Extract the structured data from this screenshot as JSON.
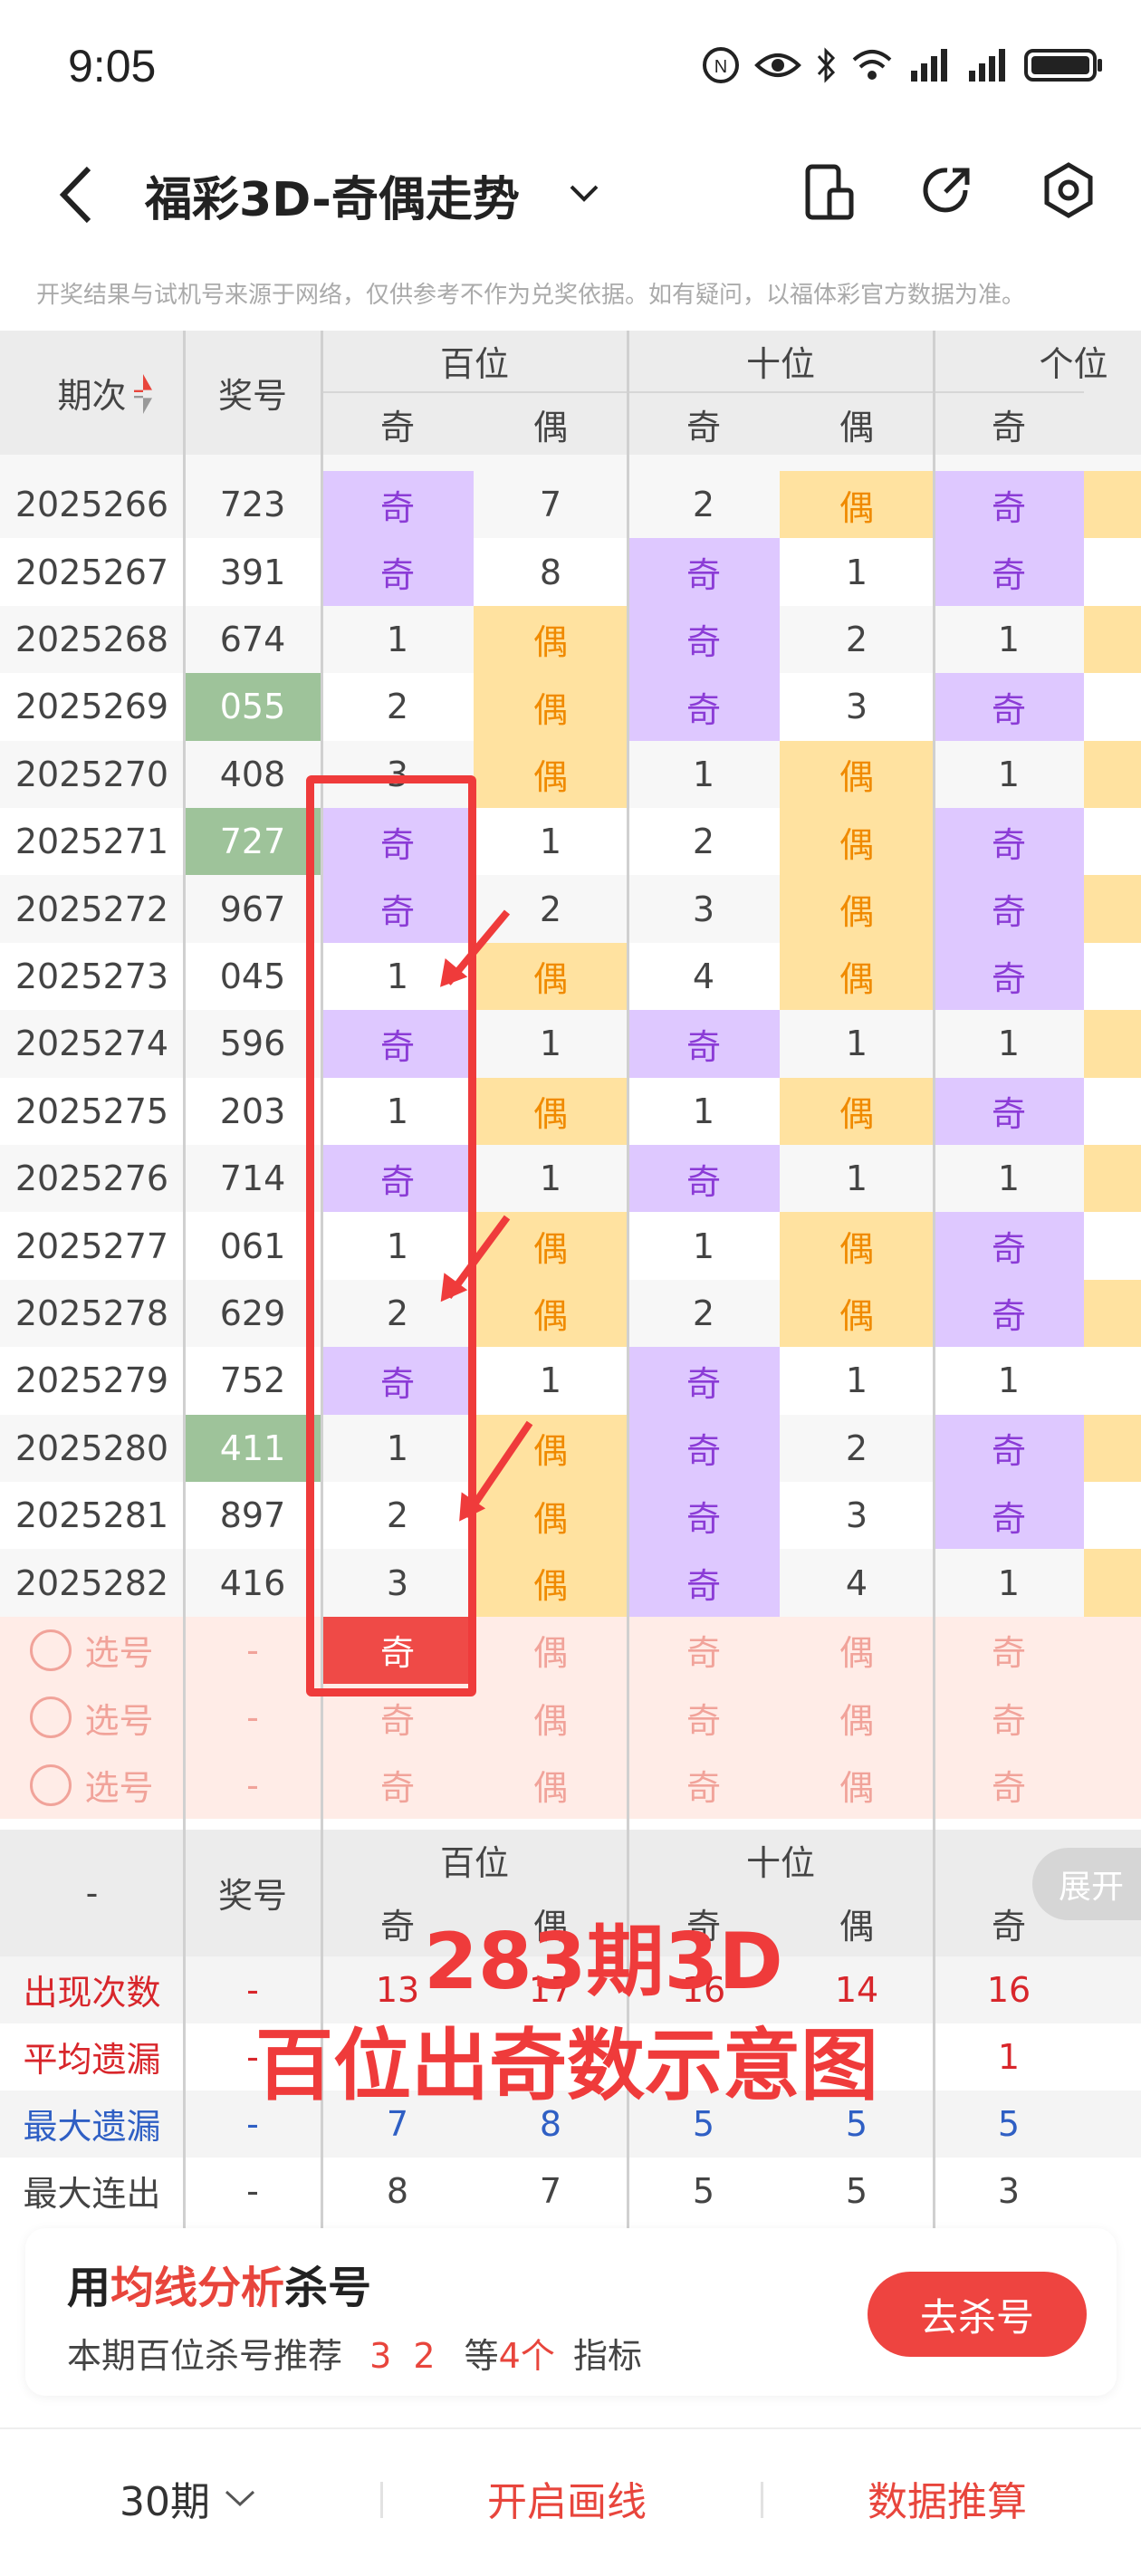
{
  "status_bar": {
    "time": "9:05"
  },
  "header": {
    "title": "福彩3D-奇偶走势"
  },
  "notice": "开奖结果与试机号来源于网络，仅供参考不作为兑奖依据。如有疑问，以福体彩官方数据为准。",
  "table": {
    "col_period": "期次",
    "col_number": "奖号",
    "groups": [
      "百位",
      "十位",
      "个位"
    ],
    "odd": "奇",
    "even": "偶",
    "rows": [
      {
        "period": "2025266",
        "number": "723",
        "bai": "奇",
        "shi": "2",
        "shi_e": "偶",
        "ge": "奇",
        "bai_e": "7"
      },
      {
        "period": "2025267",
        "number": "391",
        "bai": "奇",
        "bai_e": "8",
        "shi": "奇",
        "shi_e": "1",
        "ge": "奇"
      },
      {
        "period": "2025268",
        "number": "674",
        "bai": "1",
        "bai_e": "偶",
        "shi": "奇",
        "shi_e": "2",
        "ge": "1"
      },
      {
        "period": "2025269",
        "number": "055",
        "bai": "2",
        "bai_e": "偶",
        "shi": "奇",
        "shi_e": "3",
        "ge": "奇"
      },
      {
        "period": "2025270",
        "number": "408",
        "bai": "3",
        "bai_e": "偶",
        "shi": "1",
        "shi_e": "偶",
        "ge": "1"
      },
      {
        "period": "2025271",
        "number": "727",
        "bai": "奇",
        "bai_e": "1",
        "shi": "2",
        "shi_e": "偶",
        "ge": "奇"
      },
      {
        "period": "2025272",
        "number": "967",
        "bai": "奇",
        "bai_e": "2",
        "shi": "3",
        "shi_e": "偶",
        "ge": "奇"
      },
      {
        "period": "2025273",
        "number": "045",
        "bai": "1",
        "bai_e": "偶",
        "shi": "4",
        "shi_e": "偶",
        "ge": "奇"
      },
      {
        "period": "2025274",
        "number": "596",
        "bai": "奇",
        "bai_e": "1",
        "shi": "奇",
        "shi_e": "1",
        "ge": "1"
      },
      {
        "period": "2025275",
        "number": "203",
        "bai": "1",
        "bai_e": "偶",
        "shi": "1",
        "shi_e": "偶",
        "ge": "奇"
      },
      {
        "period": "2025276",
        "number": "714",
        "bai": "奇",
        "bai_e": "1",
        "shi": "奇",
        "shi_e": "1",
        "ge": "1"
      },
      {
        "period": "2025277",
        "number": "061",
        "bai": "1",
        "bai_e": "偶",
        "shi": "1",
        "shi_e": "偶",
        "ge": "奇"
      },
      {
        "period": "2025278",
        "number": "629",
        "bai": "2",
        "bai_e": "偶",
        "shi": "2",
        "shi_e": "偶",
        "ge": "奇"
      },
      {
        "period": "2025279",
        "number": "752",
        "bai": "奇",
        "bai_e": "1",
        "shi": "奇",
        "shi_e": "1",
        "ge": "1"
      },
      {
        "period": "2025280",
        "number": "411",
        "bai": "1",
        "bai_e": "偶",
        "shi": "奇",
        "shi_e": "2",
        "ge": "奇"
      },
      {
        "period": "2025281",
        "number": "897",
        "bai": "2",
        "bai_e": "偶",
        "shi": "奇",
        "shi_e": "3",
        "ge": "奇"
      },
      {
        "period": "2025282",
        "number": "416",
        "bai": "3",
        "bai_e": "偶",
        "shi": "奇",
        "shi_e": "4",
        "ge": "1"
      }
    ],
    "select_label": "选号",
    "dash": "-",
    "expand": "展开"
  },
  "stats": {
    "rows": [
      {
        "label": "出现次数",
        "number": "-",
        "vals": [
          "13",
          "17",
          "16",
          "14",
          "16"
        ],
        "color": "#d8262b"
      },
      {
        "label": "平均遗漏",
        "number": "-",
        "vals": [
          "",
          "",
          "",
          "",
          "1"
        ],
        "color": "#d8262b"
      },
      {
        "label": "最大遗漏",
        "number": "-",
        "vals": [
          "7",
          "8",
          "5",
          "5",
          "5"
        ],
        "color": "#2f5fc4"
      },
      {
        "label": "最大连出",
        "number": "-",
        "vals": [
          "8",
          "7",
          "5",
          "5",
          "3"
        ],
        "color": "#444444"
      }
    ]
  },
  "overlay": {
    "line1": "283期3D",
    "line2": "百位出奇数示意图"
  },
  "card": {
    "title_pre": "用",
    "title_em": "均线分析",
    "title_post": "杀号",
    "sub_pre": "本期百位杀号推荐",
    "sub_nums": "3 2",
    "sub_mid": "等",
    "sub_count": "4个",
    "sub_post": "指标",
    "button": "去杀号"
  },
  "tabbar": {
    "period": "30期",
    "draw": "开启画线",
    "calc": "数据推算"
  },
  "colors": {
    "accent": "#e8453c",
    "purple": "#dec8ff",
    "orange": "#ffe2a0"
  }
}
